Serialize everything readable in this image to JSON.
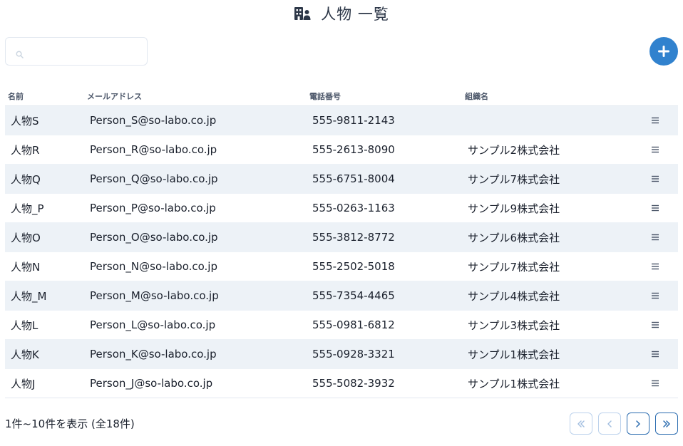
{
  "header": {
    "title": "人物 一覧",
    "icon": "building-user-icon"
  },
  "search": {
    "value": "",
    "placeholder": "",
    "icon": "search-icon"
  },
  "actions": {
    "add_icon": "plus-icon",
    "accent": "#3182ce"
  },
  "table": {
    "columns": [
      "名前",
      "メールアドレス",
      "電話番号",
      "組織名",
      ""
    ],
    "rows": [
      {
        "name": "人物S",
        "email": "Person_S@so-labo.co.jp",
        "phone": "555-9811-2143",
        "org": ""
      },
      {
        "name": "人物R",
        "email": "Person_R@so-labo.co.jp",
        "phone": "555-2613-8090",
        "org": "サンプル2株式会社"
      },
      {
        "name": "人物Q",
        "email": "Person_Q@so-labo.co.jp",
        "phone": "555-6751-8004",
        "org": "サンプル7株式会社"
      },
      {
        "name": "人物_P",
        "email": "Person_P@so-labo.co.jp",
        "phone": "555-0263-1163",
        "org": "サンプル9株式会社"
      },
      {
        "name": "人物O",
        "email": "Person_O@so-labo.co.jp",
        "phone": "555-3812-8772",
        "org": "サンプル6株式会社"
      },
      {
        "name": "人物N",
        "email": "Person_N@so-labo.co.jp",
        "phone": "555-2502-5018",
        "org": "サンプル7株式会社"
      },
      {
        "name": "人物_M",
        "email": "Person_M@so-labo.co.jp",
        "phone": "555-7354-4465",
        "org": "サンプル4株式会社"
      },
      {
        "name": "人物L",
        "email": "Person_L@so-labo.co.jp",
        "phone": "555-0981-6812",
        "org": "サンプル3株式会社"
      },
      {
        "name": "人物K",
        "email": "Person_K@so-labo.co.jp",
        "phone": "555-0928-3321",
        "org": "サンプル1株式会社"
      },
      {
        "name": "人物J",
        "email": "Person_J@so-labo.co.jp",
        "phone": "555-5082-3932",
        "org": "サンプル1株式会社"
      }
    ],
    "row_menu_icon": "hamburger-menu-icon"
  },
  "footer": {
    "summary": "1件~10件を表示 (全18件)"
  },
  "pagination": [
    {
      "icon": "double-chevron-left-icon",
      "enabled": false
    },
    {
      "icon": "chevron-left-icon",
      "enabled": false
    },
    {
      "icon": "chevron-right-icon",
      "enabled": true
    },
    {
      "icon": "double-chevron-right-icon",
      "enabled": true
    }
  ]
}
